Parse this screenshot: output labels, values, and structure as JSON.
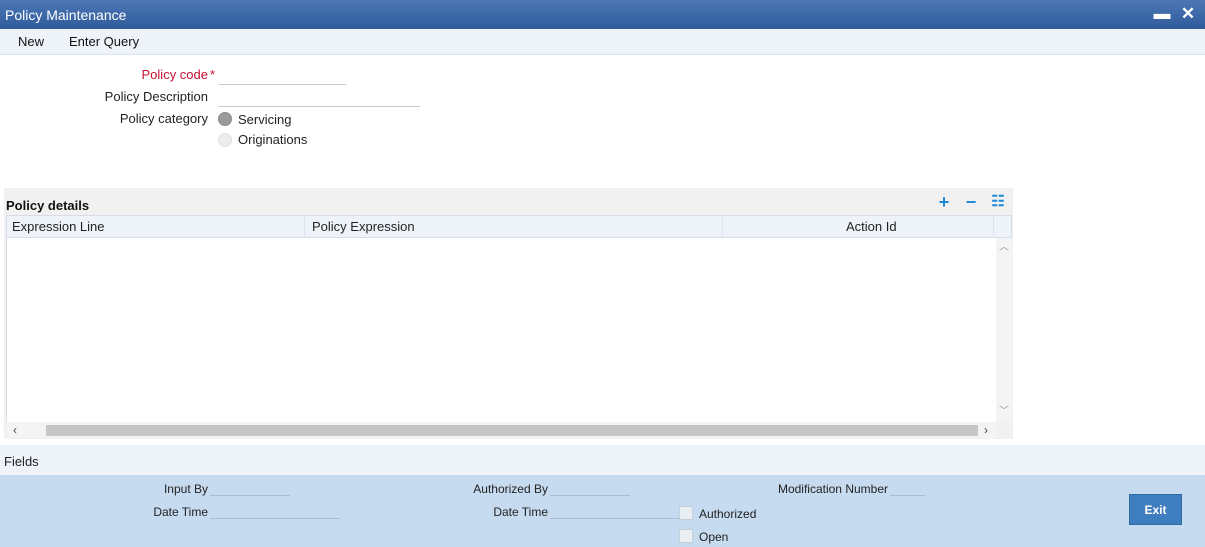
{
  "window": {
    "title": "Policy Maintenance",
    "minimize_glyph": "▬",
    "close_glyph": "✕"
  },
  "menu": {
    "new_label": "New",
    "enter_query_label": "Enter Query"
  },
  "form": {
    "policy_code_label": "Policy code",
    "required_marker": "*",
    "policy_code_value": "",
    "policy_description_label": "Policy Description",
    "policy_description_value": "",
    "policy_category_label": "Policy category",
    "category_options": [
      {
        "label": "Servicing",
        "selected": true
      },
      {
        "label": "Originations",
        "selected": false
      }
    ]
  },
  "grid": {
    "title": "Policy details",
    "add_icon": "+",
    "remove_icon": "−",
    "view_icon": "☷",
    "columns": [
      "Expression Line",
      "Policy Expression",
      "Action Id"
    ],
    "rows": [],
    "scroll_up": "︿",
    "scroll_down": "﹀",
    "scroll_left": "‹",
    "scroll_right": "›"
  },
  "fields_bar": {
    "label": "Fields"
  },
  "footer": {
    "input_by_label": "Input By",
    "input_by_value": "",
    "date_time_label": "Date Time",
    "date_time_value": "",
    "authorized_by_label": "Authorized By",
    "authorized_by_value": "",
    "auth_date_time_label": "Date Time",
    "auth_date_time_value": "",
    "modification_number_label": "Modification Number",
    "modification_number_value": "",
    "authorized_label": "Authorized",
    "authorized_checked": false,
    "open_label": "Open",
    "open_checked": false,
    "exit_label": "Exit"
  },
  "colors": {
    "titlebar": "#2f5c9c",
    "required": "#c8102e",
    "footer": "#c6dbef",
    "accent_icon": "#1e8ad6",
    "exit_button": "#3f7ebe"
  }
}
